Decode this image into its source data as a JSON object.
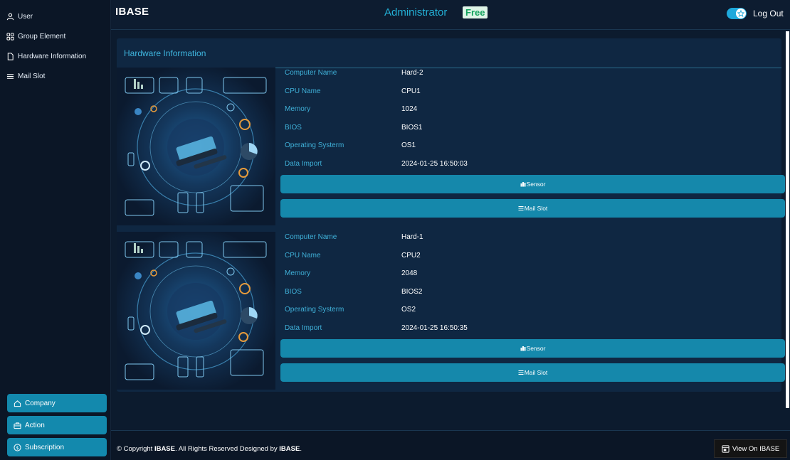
{
  "sidebar": {
    "items": [
      {
        "label": "User",
        "icon": "user-icon"
      },
      {
        "label": "Group Element",
        "icon": "grid-icon"
      },
      {
        "label": "Hardware Information",
        "icon": "document-icon"
      },
      {
        "label": "Mail Slot",
        "icon": "menu-icon"
      }
    ],
    "bottom": [
      {
        "label": "Company",
        "icon": "home-icon"
      },
      {
        "label": "Action",
        "icon": "briefcase-icon"
      },
      {
        "label": "Subscription",
        "icon": "dollar-icon"
      }
    ]
  },
  "header": {
    "brand": "IBASE",
    "role": "Administrator",
    "plan": "Free",
    "logout": "Log Out"
  },
  "panel": {
    "title": "Hardware Information",
    "field_labels": {
      "computer_name": "Computer Name",
      "cpu_name": "CPU Name",
      "memory": "Memory",
      "bios": "BIOS",
      "os": "Operating Systerm",
      "data_import": "Data Import"
    },
    "sensor_label": "Sensor",
    "mailslot_label": "Mail Slot",
    "devices": [
      {
        "computer_name": "Hard-2",
        "cpu_name": "CPU1",
        "memory": "1024",
        "bios": "BIOS1",
        "os": "OS1",
        "data_import": "2024-01-25 16:50:03"
      },
      {
        "computer_name": "Hard-1",
        "cpu_name": "CPU2",
        "memory": "2048",
        "bios": "BIOS2",
        "os": "OS2",
        "data_import": "2024-01-25 16:50:35"
      }
    ]
  },
  "footer": {
    "copyright_prefix": "© Copyright ",
    "copyright_brand": "IBASE",
    "copyright_mid": ". All Rights Reserved Designed by ",
    "copyright_brand2": "IBASE",
    "copyright_end": ".",
    "view_button": "View On IBASE"
  },
  "colors": {
    "accent": "#1588ab",
    "label": "#3fb0d8",
    "plan_badge": "#14a35e",
    "background": "#0c1b2e"
  }
}
